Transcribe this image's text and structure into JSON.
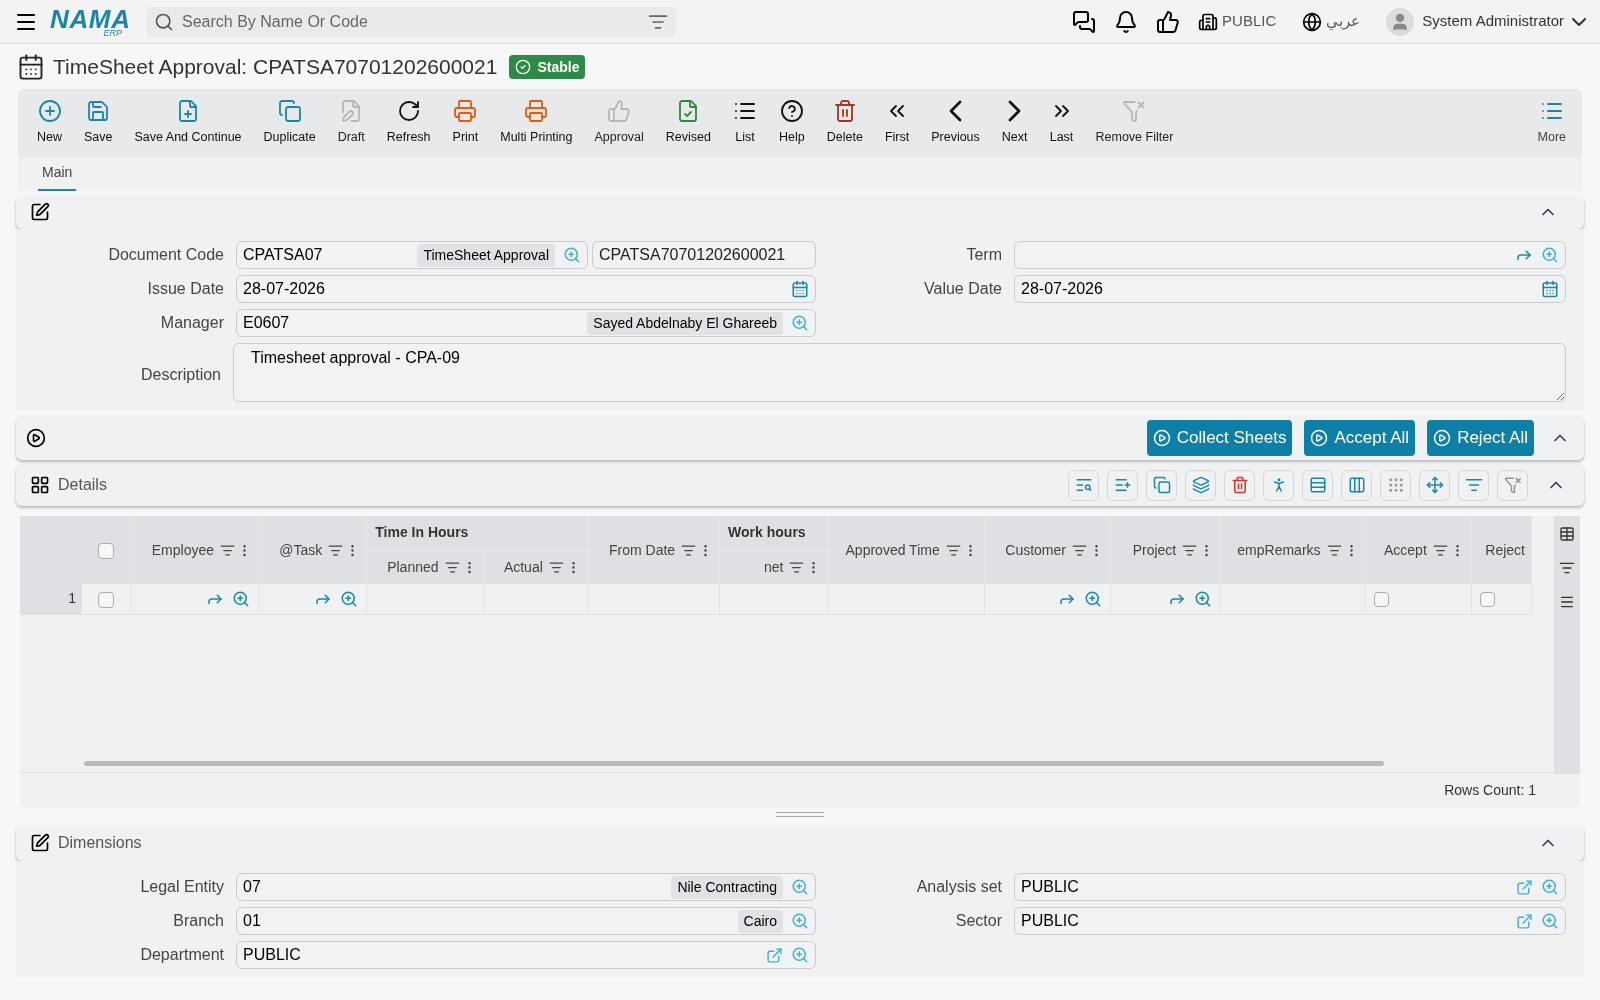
{
  "topbar": {
    "logo": "NAMA",
    "logo_sub": "ERP",
    "search": {
      "placeholder": "Search By Name Or Code"
    },
    "company": "PUBLIC",
    "language": "عربي",
    "user": "System Administrator"
  },
  "title": "TimeSheet Approval: CPATSA70701202600021",
  "status": "Stable",
  "toolbar": [
    {
      "label": "New",
      "disabled": false
    },
    {
      "label": "Save",
      "disabled": false
    },
    {
      "label": "Save And Continue",
      "disabled": false
    },
    {
      "label": "Duplicate",
      "disabled": false
    },
    {
      "label": "Draft",
      "disabled": true
    },
    {
      "label": "Refresh",
      "disabled": false
    },
    {
      "label": "Print",
      "disabled": false
    },
    {
      "label": "Multi Printing",
      "disabled": false
    },
    {
      "label": "Approval",
      "disabled": true
    },
    {
      "label": "Revised",
      "disabled": false
    },
    {
      "label": "List",
      "disabled": false
    },
    {
      "label": "Help",
      "disabled": false
    },
    {
      "label": "Delete",
      "disabled": false
    },
    {
      "label": "First",
      "disabled": false
    },
    {
      "label": "Previous",
      "disabled": false
    },
    {
      "label": "Next",
      "disabled": false
    },
    {
      "label": "Last",
      "disabled": false
    },
    {
      "label": "Remove Filter",
      "disabled": true
    }
  ],
  "more": "More",
  "tabs": [
    {
      "label": "Main",
      "selected": true
    }
  ],
  "header_section": {
    "expanded": true,
    "left": [
      {
        "label": "Document Code",
        "kind": "lookup",
        "value": "CPATSA07",
        "tag": "TimeSheet Approval",
        "extra": "CPATSA70701202600021"
      },
      {
        "label": "Issue Date",
        "kind": "date",
        "value": "28-07-2026"
      },
      {
        "label": "Manager",
        "kind": "lookup",
        "value": "E0607",
        "tag": "Sayed Abdelnaby El Ghareeb"
      }
    ],
    "right": [
      {
        "label": "Term",
        "kind": "ref"
      },
      {
        "label": "Value Date",
        "kind": "date",
        "value": "28-07-2026"
      }
    ],
    "description": {
      "label": "Description",
      "value": "Timesheet approval - CPA-09"
    }
  },
  "actions": {
    "expanded": true,
    "buttons": [
      "Collect Sheets",
      "Accept All",
      "Reject All"
    ]
  },
  "details": {
    "title": "Details",
    "expanded": true,
    "columns": [
      {
        "label": "Employee",
        "kind": "lookup"
      },
      {
        "label": "@Task",
        "kind": "lookup"
      },
      {
        "group": "Time In Hours",
        "children": [
          {
            "label": "Planned",
            "kind": "text"
          },
          {
            "label": "Actual",
            "kind": "text"
          }
        ]
      },
      {
        "label": "From Date",
        "kind": "text"
      },
      {
        "group": "Work hours",
        "children": [
          {
            "label": "net",
            "kind": "text"
          }
        ]
      },
      {
        "label": "Approved Time",
        "kind": "text"
      },
      {
        "label": "Customer",
        "kind": "lookup"
      },
      {
        "label": "Project",
        "kind": "lookup"
      },
      {
        "label": "empRemarks",
        "kind": "text"
      },
      {
        "label": "Accept",
        "kind": "check"
      },
      {
        "label": "Reject",
        "kind": "check"
      }
    ],
    "all_checked": false,
    "rows": [
      {
        "number": "1",
        "checked": false,
        "checks": [
          false,
          false
        ]
      }
    ],
    "rows_count": "Rows Count: 1"
  },
  "dimensions": {
    "title": "Dimensions",
    "expanded": true,
    "left": [
      {
        "label": "Legal Entity",
        "kind": "lookup",
        "value": "07",
        "tag": "Nile Contracting"
      },
      {
        "label": "Branch",
        "kind": "lookup",
        "value": "01",
        "tag": "Cairo"
      },
      {
        "label": "Department",
        "kind": "open",
        "value": "PUBLIC"
      }
    ],
    "right": [
      {
        "label": "Analysis set",
        "kind": "open",
        "value": "PUBLIC"
      },
      {
        "label": "Sector",
        "kind": "open",
        "value": "PUBLIC"
      }
    ]
  }
}
